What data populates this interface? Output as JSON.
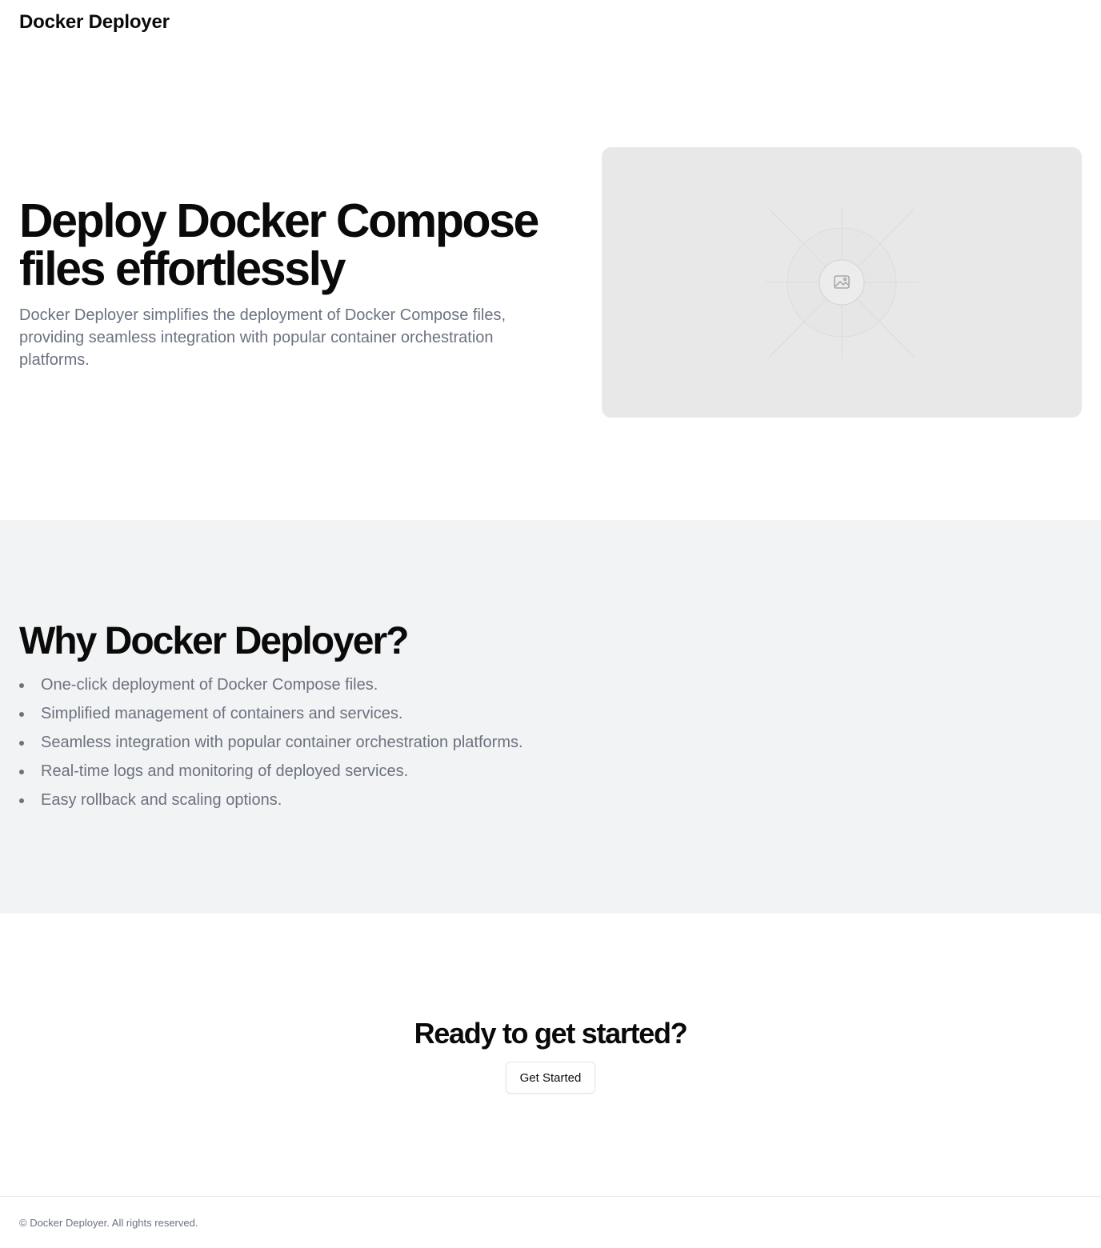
{
  "header": {
    "brand": "Docker Deployer"
  },
  "hero": {
    "title": "Deploy Docker Compose files effortlessly",
    "subtitle": "Docker Deployer simplifies the deployment of Docker Compose files, providing seamless integration with popular container orchestration platforms.",
    "image_icon": "image-placeholder-icon"
  },
  "features": {
    "title": "Why Docker Deployer?",
    "items": [
      "One-click deployment of Docker Compose files.",
      "Simplified management of containers and services.",
      "Seamless integration with popular container orchestration platforms.",
      "Real-time logs and monitoring of deployed services.",
      "Easy rollback and scaling options."
    ]
  },
  "cta": {
    "title": "Ready to get started?",
    "button_label": "Get Started"
  },
  "footer": {
    "text": "© Docker Deployer. All rights reserved."
  },
  "colors": {
    "text": "#0a0a0a",
    "muted": "#6b7280",
    "features_bg": "#f2f3f4",
    "placeholder_bg": "#e8e8e8"
  }
}
